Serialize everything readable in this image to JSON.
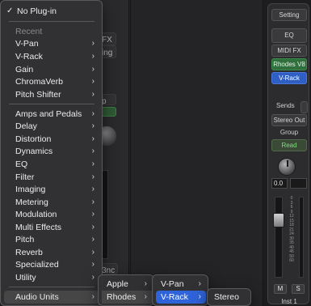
{
  "background": {
    "slots": [
      "FX",
      "ing",
      "p",
      "3nc"
    ]
  },
  "inspector": {
    "setting_label": "Setting",
    "eq_label": "EQ",
    "midi_fx_label": "MIDI FX",
    "instrument_label": "Rhodes V8",
    "audio_fx_label": "V-Rack",
    "sends_label": "Sends",
    "output_label": "Stereo Out",
    "group_label": "Group",
    "automation_label": "Read",
    "volume_value": "0.0",
    "meter_ticks": [
      "0",
      "3",
      "6",
      "9",
      "12",
      "15",
      "18",
      "21",
      "24",
      "30",
      "35",
      "40",
      "45",
      "50",
      "60"
    ],
    "mute_label": "M",
    "solo_label": "S",
    "track_name": "Inst 1",
    "colors": {
      "instrument": "#2f6f3c",
      "audio_fx": "#2f5fc4",
      "automation_text": "#7fe07f"
    }
  },
  "plugin_menu": {
    "no_plugin_label": "No Plug-in",
    "no_plugin_checked": true,
    "recent_header": "Recent",
    "recent_items": [
      "V-Pan",
      "V-Rack",
      "Gain",
      "ChromaVerb",
      "Pitch Shifter"
    ],
    "category_items": [
      "Amps and Pedals",
      "Delay",
      "Distortion",
      "Dynamics",
      "EQ",
      "Filter",
      "Imaging",
      "Metering",
      "Modulation",
      "Multi Effects",
      "Pitch",
      "Reverb",
      "Specialized",
      "Utility"
    ],
    "audio_units_label": "Audio Units",
    "highlight_color": "#2f63d9"
  },
  "vendor_menu": {
    "items": [
      "Apple",
      "Rhodes"
    ]
  },
  "product_menu": {
    "items": [
      "V-Pan",
      "V-Rack"
    ]
  },
  "channel_menu": {
    "items": [
      "Stereo"
    ]
  }
}
